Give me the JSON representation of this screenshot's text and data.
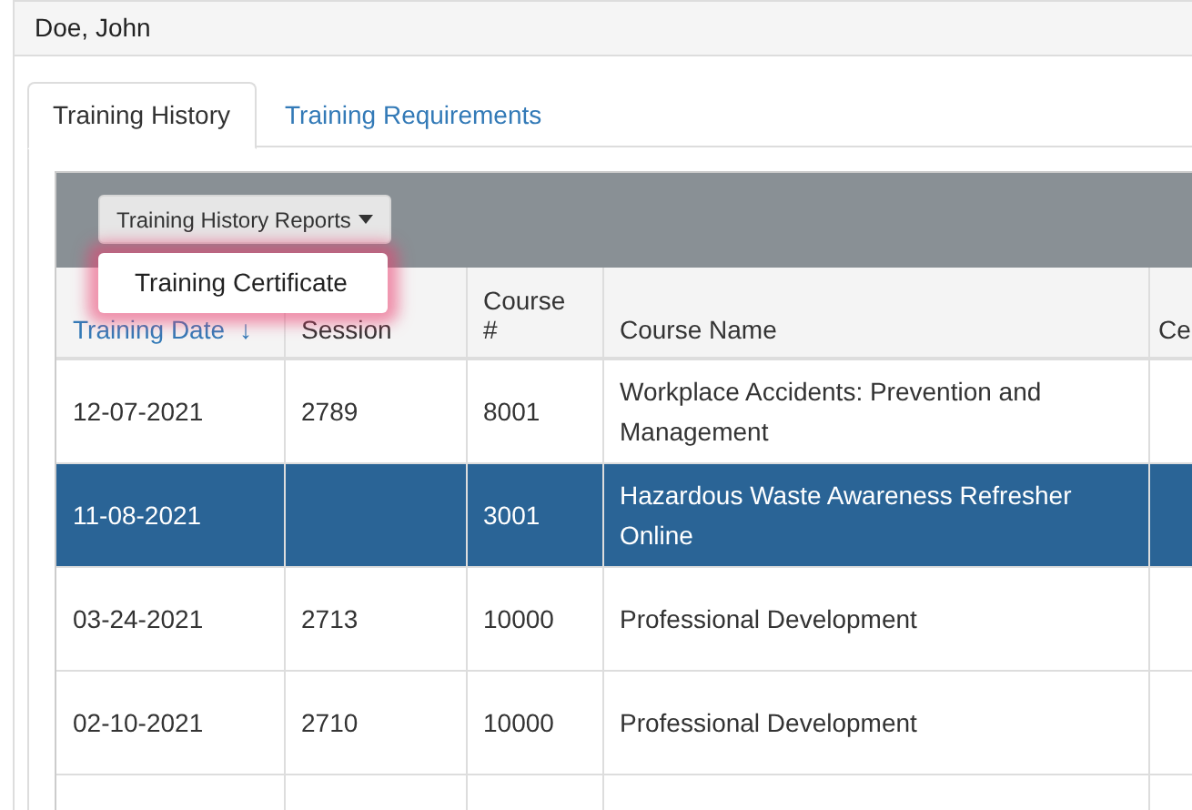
{
  "header": {
    "name": "Doe, John"
  },
  "tabs": [
    {
      "label": "Training History",
      "selected": true
    },
    {
      "label": "Training Requirements",
      "selected": false
    }
  ],
  "toolbar": {
    "reports_button": "Training History Reports",
    "menu": {
      "expanded": true,
      "items": [
        "Training Certificate"
      ]
    }
  },
  "table": {
    "columns": [
      {
        "label": "Training Date",
        "sorted": true,
        "sort_icon": "↓"
      },
      {
        "label": "Session",
        "sorted": false
      },
      {
        "label": "Course #",
        "sorted": false
      },
      {
        "label": "Course Name",
        "sorted": false
      },
      {
        "label": "Ce",
        "sorted": false
      }
    ],
    "rows": [
      {
        "selected": false,
        "cells": [
          "12-07-2021",
          "2789",
          "8001",
          "Workplace Accidents: Prevention and Management",
          ""
        ]
      },
      {
        "selected": true,
        "cells": [
          "11-08-2021",
          "",
          "3001",
          "Hazardous Waste Awareness Refresher Online",
          ""
        ]
      },
      {
        "selected": false,
        "cells": [
          "03-24-2021",
          "2713",
          "10000",
          "Professional Development",
          ""
        ]
      },
      {
        "selected": false,
        "cells": [
          "02-10-2021",
          "2710",
          "10000",
          "Professional Development",
          ""
        ]
      }
    ]
  }
}
